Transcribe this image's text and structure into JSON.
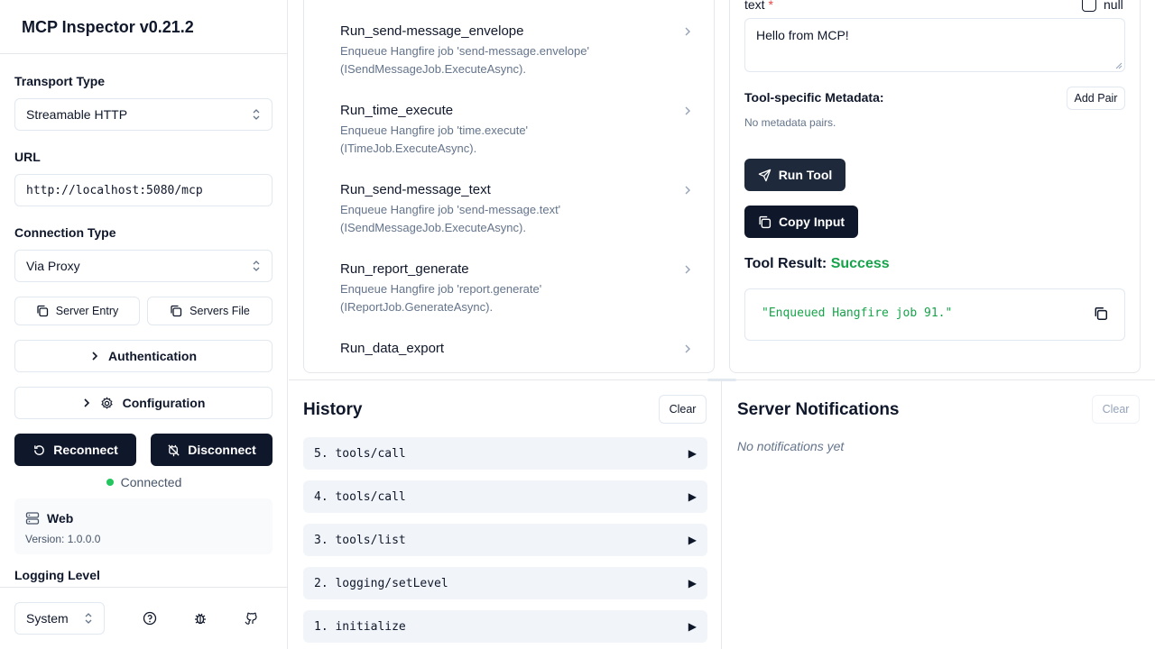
{
  "app": {
    "title": "MCP Inspector v0.21.2"
  },
  "sidebar": {
    "transport_label": "Transport Type",
    "transport_value": "Streamable HTTP",
    "url_label": "URL",
    "url_value": "http://localhost:5080/mcp",
    "connection_label": "Connection Type",
    "connection_value": "Via Proxy",
    "server_entry_label": "Server Entry",
    "servers_file_label": "Servers File",
    "authentication_label": "Authentication",
    "configuration_label": "Configuration",
    "reconnect_label": "Reconnect",
    "disconnect_label": "Disconnect",
    "status_text": "Connected",
    "status_color": "#22c55e",
    "server_name": "Web",
    "server_version": "Version: 1.0.0.0",
    "logging_label": "Logging Level",
    "theme_value": "System"
  },
  "tools": {
    "items": [
      {
        "name": "Run_send-message_envelope",
        "desc1": "Enqueue Hangfire job 'send-message.envelope'",
        "desc2": "(ISendMessageJob.ExecuteAsync)."
      },
      {
        "name": "Run_time_execute",
        "desc1": "Enqueue Hangfire job 'time.execute'",
        "desc2": "(ITimeJob.ExecuteAsync)."
      },
      {
        "name": "Run_send-message_text",
        "desc1": "Enqueue Hangfire job 'send-message.text'",
        "desc2": "(ISendMessageJob.ExecuteAsync)."
      },
      {
        "name": "Run_report_generate",
        "desc1": "Enqueue Hangfire job 'report.generate'",
        "desc2": "(IReportJob.GenerateAsync)."
      },
      {
        "name": "Run_data_export",
        "desc1": "",
        "desc2": ""
      }
    ]
  },
  "detail": {
    "field_label": "text",
    "required_mark": "*",
    "null_label": "null",
    "text_value": "Hello from MCP!",
    "metadata_label": "Tool-specific Metadata:",
    "add_pair_label": "Add Pair",
    "no_metadata": "No metadata pairs.",
    "run_tool_label": "Run Tool",
    "copy_input_label": "Copy Input",
    "result_label": "Tool Result:",
    "result_status": "Success",
    "result_text": "\"Enqueued Hangfire job 91.\""
  },
  "history": {
    "title": "History",
    "clear_label": "Clear",
    "rows": [
      "5. tools/call",
      "4. tools/call",
      "3. tools/list",
      "2. logging/setLevel",
      "1. initialize"
    ],
    "play_glyph": "▶"
  },
  "notifications": {
    "title": "Server Notifications",
    "clear_label": "Clear",
    "empty_text": "No notifications yet"
  }
}
